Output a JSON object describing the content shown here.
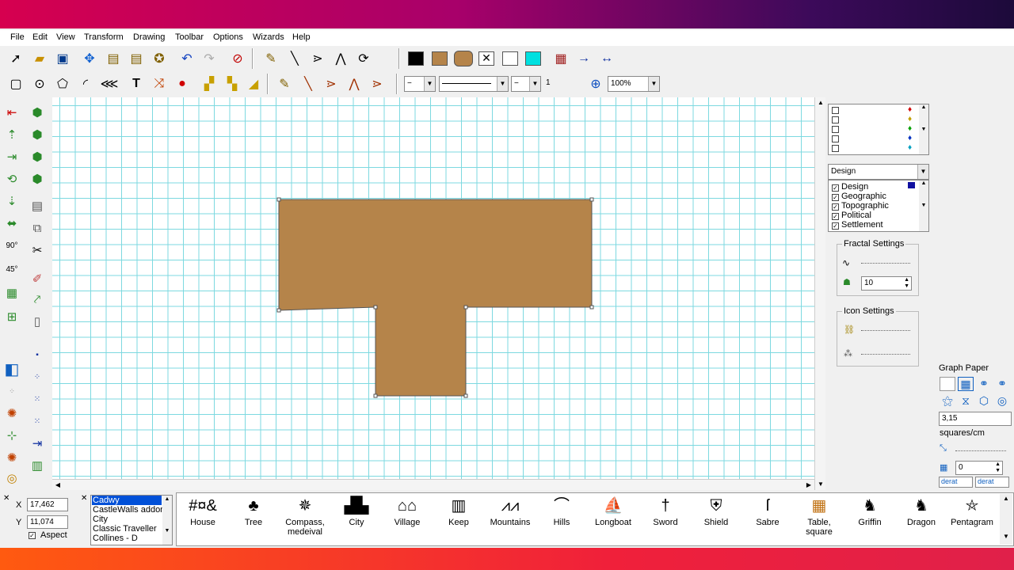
{
  "menu": [
    "File",
    "Edit",
    "View",
    "Transform",
    "Drawing",
    "Toolbar",
    "Options",
    "Wizards",
    "Help"
  ],
  "menu_underline": [
    "F",
    "E",
    "V",
    "T",
    "D",
    "T",
    "O",
    "W",
    "H"
  ],
  "toolbar": {
    "line_width_value": "1",
    "zoom_value": "100%",
    "line_style_a": "−",
    "line_style_b": "−"
  },
  "colors": {
    "shape_fill": "#b5844a",
    "grid": "#7dd9e0",
    "top_gradient": [
      "#d6004f",
      "#1c0a3a"
    ],
    "bottom_gradient": [
      "#ff5a10",
      "#e0204a"
    ],
    "swatch_black": "#000000",
    "swatch_brown": "#b5844a",
    "swatch_cyan": "#00e0e0"
  },
  "layers": {
    "dropdown_value": "Design",
    "items": [
      "Design",
      "Geographic",
      "Topographic",
      "Political",
      "Settlement"
    ]
  },
  "fractal_settings": {
    "title": "Fractal Settings",
    "value": "10"
  },
  "icon_settings": {
    "title": "Icon Settings"
  },
  "graph_paper": {
    "title": "Graph Paper",
    "value": "3,15",
    "unit": "squares/cm",
    "spin_value": "0",
    "combo_a": "derat",
    "combo_b": "derat"
  },
  "coords": {
    "x_label": "X",
    "y_label": "Y",
    "x": "17,462",
    "y": "11,074",
    "aspect_label": "Aspect"
  },
  "collections": [
    "Cadwy",
    "CastleWalls addon",
    "City",
    "Classic Traveller",
    "Collines - D"
  ],
  "symbols": [
    {
      "label": "House",
      "icon": "#¤&"
    },
    {
      "label": "Tree",
      "icon": "♣"
    },
    {
      "label": "Compass, medeival",
      "icon": "✵"
    },
    {
      "label": "City",
      "icon": "▟▙"
    },
    {
      "label": "Village",
      "icon": "⌂⌂"
    },
    {
      "label": "Keep",
      "icon": "▥"
    },
    {
      "label": "Mountains",
      "icon": "⩘⩘"
    },
    {
      "label": "Hills",
      "icon": "⌒"
    },
    {
      "label": "Longboat",
      "icon": "⛵"
    },
    {
      "label": "Sword",
      "icon": "†"
    },
    {
      "label": "Shield",
      "icon": "⛨"
    },
    {
      "label": "Sabre",
      "icon": "ſ"
    },
    {
      "label": "Table, square",
      "icon": "▦"
    },
    {
      "label": "Griffin",
      "icon": "♞"
    },
    {
      "label": "Dragon",
      "icon": "♞"
    },
    {
      "label": "Pentagram",
      "icon": "⛤"
    }
  ]
}
